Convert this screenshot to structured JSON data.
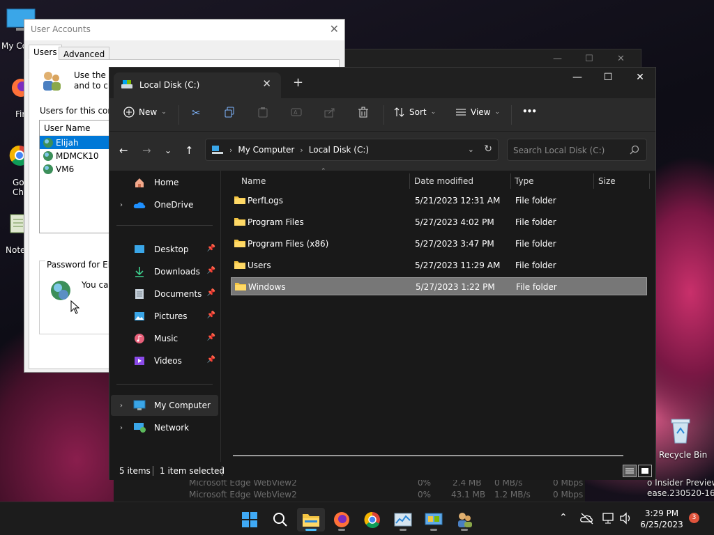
{
  "desktop": {
    "icons": [
      {
        "label": "My Co"
      },
      {
        "label": "Fir"
      },
      {
        "label": "Go Chr"
      },
      {
        "label": "Note"
      },
      {
        "label": "Recycle Bin"
      }
    ],
    "insider_line1": "o Insider Preview",
    "insider_line2": "ease.230520-1632"
  },
  "task_manager_rows": [
    {
      "name": "Microsoft Edge WebView2",
      "cpu": "0%",
      "mem": "2.4 MB",
      "disk": "0 MB/s",
      "net": "0 Mbps"
    },
    {
      "name": "Microsoft Edge WebView2",
      "cpu": "0%",
      "mem": "43.1 MB",
      "disk": "1.2 MB/s",
      "net": "0 Mbps"
    }
  ],
  "user_accounts": {
    "title": "User Accounts",
    "tabs": [
      "Users",
      "Advanced"
    ],
    "intro_line1": "Use the lis",
    "intro_line2": "and to ch",
    "users_label": "Users for this comp",
    "list_header": "User Name",
    "users": [
      "Elijah",
      "MDMCK10",
      "VM6"
    ],
    "password_group": "Password for Elija",
    "password_text": "You ca"
  },
  "explorer": {
    "tab_title": "Local Disk (C:)",
    "toolbar": {
      "new_label": "New",
      "sort_label": "Sort",
      "view_label": "View",
      "more_label": "•••"
    },
    "breadcrumb": [
      "My Computer",
      "Local Disk (C:)"
    ],
    "search_placeholder": "Search Local Disk (C:)",
    "nav": {
      "home": "Home",
      "onedrive": "OneDrive",
      "desktop": "Desktop",
      "downloads": "Downloads",
      "documents": "Documents",
      "pictures": "Pictures",
      "music": "Music",
      "videos": "Videos",
      "mycomputer": "My Computer",
      "network": "Network"
    },
    "columns": [
      "Name",
      "Date modified",
      "Type",
      "Size"
    ],
    "files": [
      {
        "name": "PerfLogs",
        "date": "5/21/2023 12:31 AM",
        "type": "File folder"
      },
      {
        "name": "Program Files",
        "date": "5/27/2023 4:02 PM",
        "type": "File folder"
      },
      {
        "name": "Program Files (x86)",
        "date": "5/27/2023 3:47 PM",
        "type": "File folder"
      },
      {
        "name": "Users",
        "date": "5/27/2023 11:29 AM",
        "type": "File folder"
      },
      {
        "name": "Windows",
        "date": "5/27/2023 1:22 PM",
        "type": "File folder"
      }
    ],
    "status": {
      "items": "5 items",
      "selected": "1 item selected"
    }
  },
  "taskbar": {
    "time": "3:29 PM",
    "date": "6/25/2023",
    "notifications": "3"
  },
  "colors": {
    "accent": "#4cc2ff",
    "folder": "#f4c542",
    "selection": "#777777"
  }
}
